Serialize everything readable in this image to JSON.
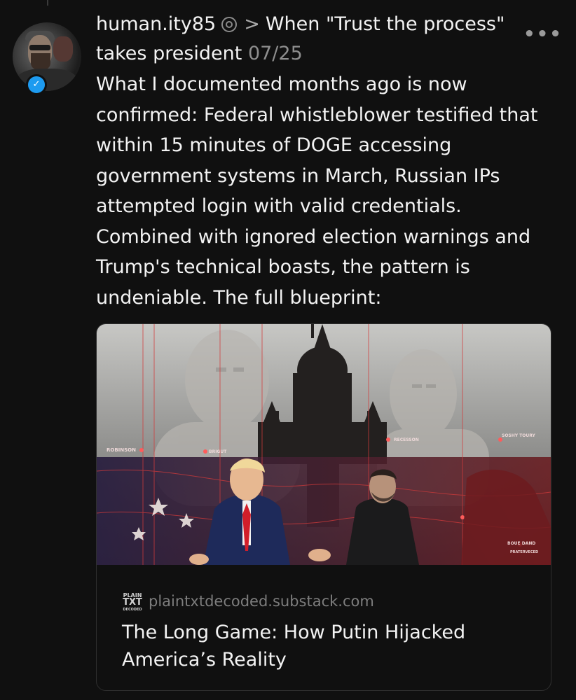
{
  "author": {
    "username": "human.ity85",
    "verified": true
  },
  "post": {
    "thread_topic": "When \"Trust the process\" takes president",
    "date": "07/25",
    "text": "What I documented months ago is now confirmed: Federal whistleblower testified that within 15 minutes of DOGE accessing government systems in March, Russian IPs attempted login with valid credentials. Combined with ignored election warnings and Trump's technical boasts, the pattern is undeniable. The full blueprint:"
  },
  "link_card": {
    "site_logo": [
      "PLAIN",
      "TXT",
      "DECODED"
    ],
    "domain": "plaintxtdecoded.substack.com",
    "title": "The Long Game: How Putin Hijacked America’s Reality",
    "image_labels": [
      "ROBINSON",
      "RECESSON",
      "SOSHY TOURY",
      "BRIGUT",
      "BOUE DAND",
      "PRATERVECED"
    ]
  },
  "icons": {
    "more": "more-options-icon",
    "verified": "verified-check-icon",
    "thread": "thread-ring-icon",
    "chevron": "chevron-right-icon"
  },
  "colors": {
    "background": "#101010",
    "text": "#f3f3f3",
    "muted": "#8e8e8e",
    "verified": "#1d9bf0"
  }
}
